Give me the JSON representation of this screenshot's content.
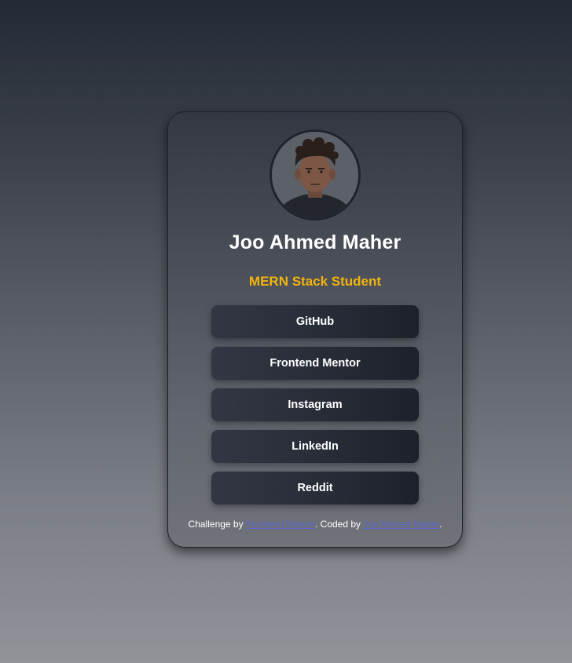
{
  "profile": {
    "avatar_alt": "Joo Ahmed Maher",
    "name": "Joo Ahmed Maher",
    "role": "MERN Stack Student"
  },
  "links": [
    {
      "label": "GitHub"
    },
    {
      "label": "Frontend Mentor"
    },
    {
      "label": "Instagram"
    },
    {
      "label": "LinkedIn"
    },
    {
      "label": "Reddit"
    }
  ],
  "footer": {
    "prefix": "Challenge by ",
    "challenge_link": "Frontend Mentor",
    "middle": ". Coded by ",
    "author_link": "Joo Ahmed Maher",
    "suffix": "."
  },
  "colors": {
    "accent": "#f2b40c",
    "button_bg": "#272c37",
    "link": "#5b66c9"
  }
}
